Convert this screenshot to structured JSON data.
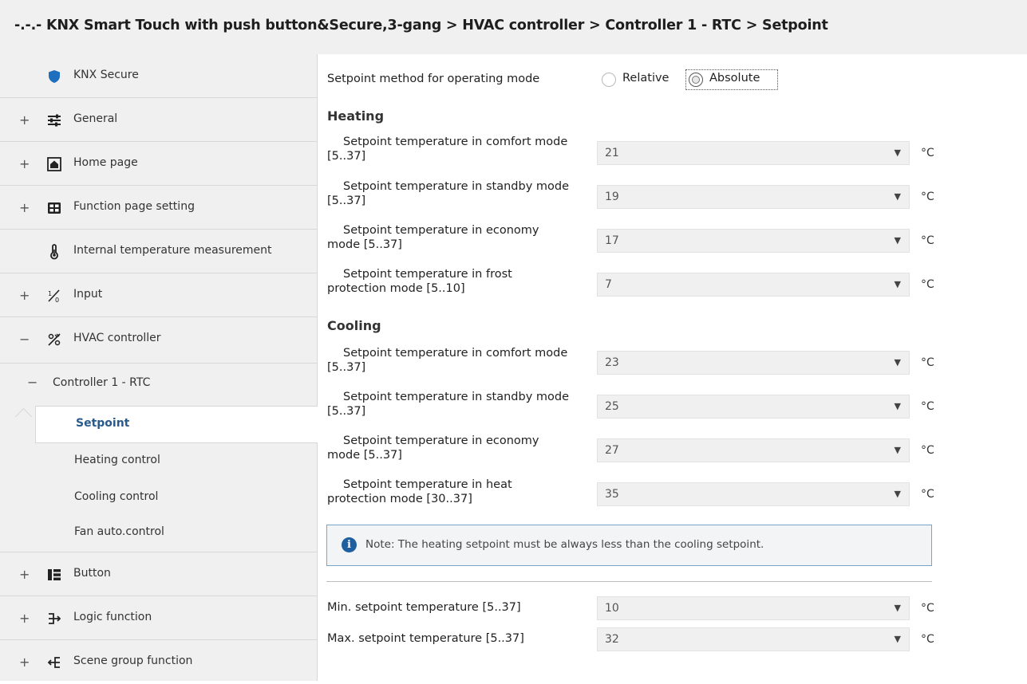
{
  "breadcrumb": "-.-.- KNX Smart Touch with push button&Secure,3-gang > HVAC controller > Controller 1 - RTC > Setpoint",
  "sidebar": {
    "items": [
      {
        "expander": "",
        "label": "KNX Secure",
        "icon": "shield-icon"
      },
      {
        "expander": "+",
        "label": "General",
        "icon": "sliders-icon"
      },
      {
        "expander": "+",
        "label": "Home page",
        "icon": "home-icon"
      },
      {
        "expander": "+",
        "label": "Function page setting",
        "icon": "grid-icon"
      },
      {
        "expander": "",
        "label": "Internal temperature measurement",
        "icon": "thermometer-icon"
      },
      {
        "expander": "+",
        "label": "Input",
        "icon": "input-icon"
      },
      {
        "expander": "−",
        "label": "HVAC controller",
        "icon": "hvac-icon"
      }
    ],
    "controller": {
      "expander": "−",
      "label": "Controller 1 - RTC"
    },
    "subitems": [
      {
        "label": "Setpoint",
        "selected": true
      },
      {
        "label": "Heating control",
        "selected": false
      },
      {
        "label": "Cooling control",
        "selected": false
      },
      {
        "label": "Fan auto.control",
        "selected": false
      }
    ],
    "bottom_items": [
      {
        "expander": "+",
        "label": "Button",
        "icon": "button-icon"
      },
      {
        "expander": "+",
        "label": "Logic function",
        "icon": "logic-icon"
      },
      {
        "expander": "+",
        "label": "Scene group function",
        "icon": "scene-icon"
      }
    ]
  },
  "main": {
    "method": {
      "label": "Setpoint method for operating mode",
      "option_relative": "Relative",
      "option_absolute": "Absolute",
      "selected": "Absolute"
    },
    "heating_title": "Heating",
    "heating": [
      {
        "line1": "Setpoint temperature in comfort mode",
        "line2": "[5..37]",
        "value": "21",
        "unit": "°C"
      },
      {
        "line1": "Setpoint temperature in standby mode",
        "line2": "[5..37]",
        "value": "19",
        "unit": "°C"
      },
      {
        "line1": "Setpoint temperature in economy",
        "line2": "mode [5..37]",
        "value": "17",
        "unit": "°C"
      },
      {
        "line1": "Setpoint temperature in frost",
        "line2": "protection mode [5..10]",
        "value": "7",
        "unit": "°C"
      }
    ],
    "cooling_title": "Cooling",
    "cooling": [
      {
        "line1": "Setpoint temperature in comfort mode",
        "line2": "[5..37]",
        "value": "23",
        "unit": "°C"
      },
      {
        "line1": "Setpoint temperature in standby mode",
        "line2": "[5..37]",
        "value": "25",
        "unit": "°C"
      },
      {
        "line1": "Setpoint temperature in economy",
        "line2": "mode [5..37]",
        "value": "27",
        "unit": "°C"
      },
      {
        "line1": "Setpoint temperature in heat",
        "line2": "protection mode [30..37]",
        "value": "35",
        "unit": "°C"
      }
    ],
    "note": "Note: The heating setpoint must be always less than the cooling setpoint.",
    "limits": [
      {
        "label": "Min. setpoint temperature [5..37]",
        "value": "10",
        "unit": "°C"
      },
      {
        "label": "Max. setpoint temperature [5..37]",
        "value": "32",
        "unit": "°C"
      }
    ]
  },
  "colors": {
    "accent": "#2a5a8a",
    "shield": "#1f6fbf",
    "note_border": "#7aa3c4"
  }
}
